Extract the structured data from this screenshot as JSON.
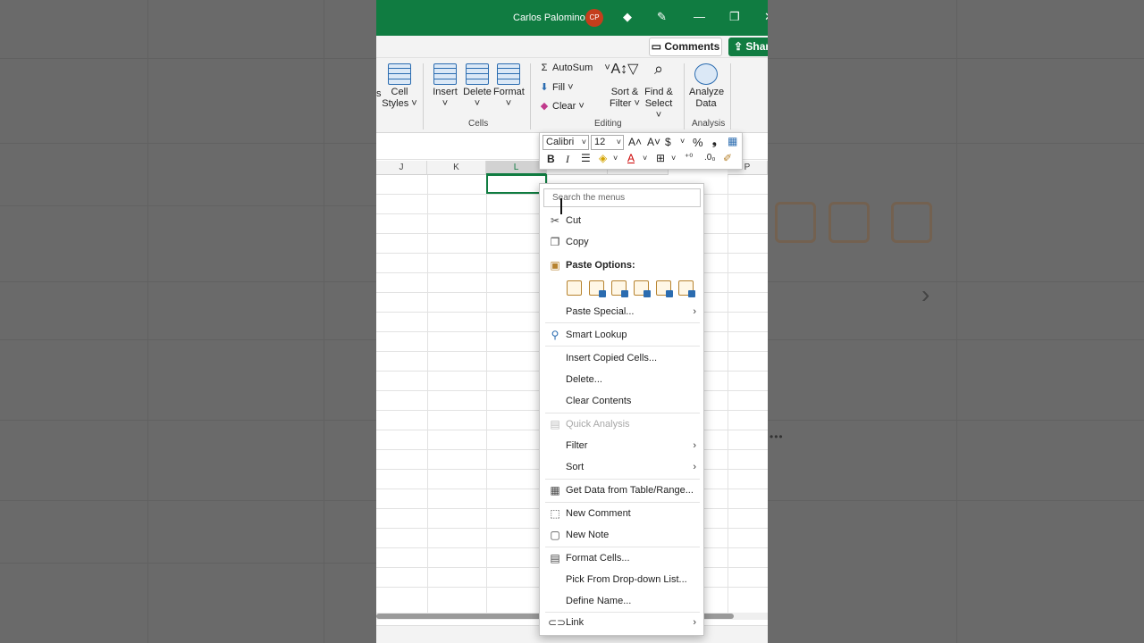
{
  "titlebar": {
    "user_name": "Carlos Palomino",
    "avatar_initials": "CP"
  },
  "commentbar": {
    "comments_label": "Comments",
    "share_label": "Share"
  },
  "ribbon": {
    "styles_partial": "s",
    "cell_styles_label": "Cell",
    "cell_styles_label2": "Styles ˅",
    "insert_label": "Insert",
    "delete_label": "Delete",
    "format_label": "Format",
    "cells_group": "Cells",
    "autosum_label": "AutoSum",
    "fill_label": "Fill",
    "clear_label": "Clear",
    "sort_filter_label": "Sort &",
    "sort_filter_label2": "Filter ˅",
    "find_select_label": "Find &",
    "find_select_label2": "Select ˅",
    "editing_group": "Editing",
    "analyze_label": "Analyze",
    "analyze_label2": "Data",
    "analysis_group": "Analysis"
  },
  "grid": {
    "columns": [
      "J",
      "K",
      "L",
      "",
      "",
      "P"
    ],
    "selected_column": "L"
  },
  "minibar": {
    "font_name": "Calibri",
    "font_size": "12",
    "bold": "B",
    "italic": "I",
    "currency": "$",
    "percent": "%",
    "comma": "❟"
  },
  "ctxmenu": {
    "search_placeholder": "Search the menus",
    "items": [
      {
        "label": "Cut",
        "icon": "scissors-icon"
      },
      {
        "label": "Copy",
        "icon": "copy-icon"
      },
      {
        "label": "Paste Options:",
        "icon": "paste-icon"
      },
      {
        "label": "Paste Special...",
        "icon": ""
      },
      {
        "label": "Smart Lookup",
        "icon": "search-icon"
      },
      {
        "label": "Insert Copied Cells...",
        "icon": ""
      },
      {
        "label": "Delete...",
        "icon": ""
      },
      {
        "label": "Clear Contents",
        "icon": ""
      },
      {
        "label": "Quick Analysis",
        "icon": "quick-analysis-icon"
      },
      {
        "label": "Filter",
        "icon": ""
      },
      {
        "label": "Sort",
        "icon": ""
      },
      {
        "label": "Get Data from Table/Range...",
        "icon": "table-icon"
      },
      {
        "label": "New Comment",
        "icon": "comment-icon"
      },
      {
        "label": "New Note",
        "icon": "note-icon"
      },
      {
        "label": "Format Cells...",
        "icon": "format-cells-icon"
      },
      {
        "label": "Pick From Drop-down List...",
        "icon": ""
      },
      {
        "label": "Define Name...",
        "icon": ""
      },
      {
        "label": "Link",
        "icon": "link-icon"
      }
    ]
  },
  "colors": {
    "excel_green": "#107c41",
    "avatar": "#c43e1c"
  }
}
